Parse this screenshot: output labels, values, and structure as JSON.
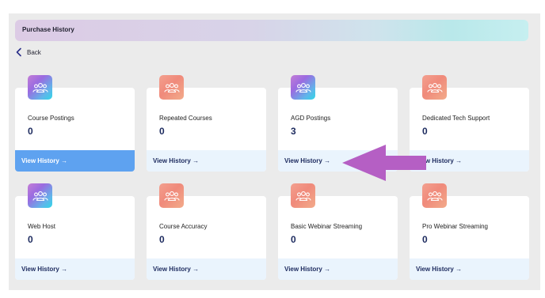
{
  "header": {
    "title": "Purchase History"
  },
  "nav": {
    "back_label": "Back"
  },
  "colors": {
    "active_footer": "#5ea2f0",
    "footer": "#eaf4fd",
    "count_text": "#1c2a5e",
    "annotation_arrow": "#b55fc4"
  },
  "cards": [
    {
      "title": "Course Postings",
      "count": "0",
      "link": "View History →",
      "icon": "group-icon",
      "icon_style": "purple",
      "active": true
    },
    {
      "title": "Repeated Courses",
      "count": "0",
      "link": "View History →",
      "icon": "group-icon",
      "icon_style": "orange"
    },
    {
      "title": "AGD Postings",
      "count": "3",
      "link": "View History →",
      "icon": "group-icon",
      "icon_style": "purple"
    },
    {
      "title": "Dedicated Tech Support",
      "count": "0",
      "link": "View History →",
      "icon": "group-icon",
      "icon_style": "orange"
    },
    {
      "title": "Web Host",
      "count": "0",
      "link": "View History →",
      "icon": "group-icon",
      "icon_style": "purple"
    },
    {
      "title": "Course Accuracy",
      "count": "0",
      "link": "View History →",
      "icon": "group-icon",
      "icon_style": "orange"
    },
    {
      "title": "Basic Webinar Streaming",
      "count": "0",
      "link": "View History →",
      "icon": "group-icon",
      "icon_style": "orange"
    },
    {
      "title": "Pro Webinar Streaming",
      "count": "0",
      "link": "View History →",
      "icon": "group-icon",
      "icon_style": "orange"
    }
  ]
}
